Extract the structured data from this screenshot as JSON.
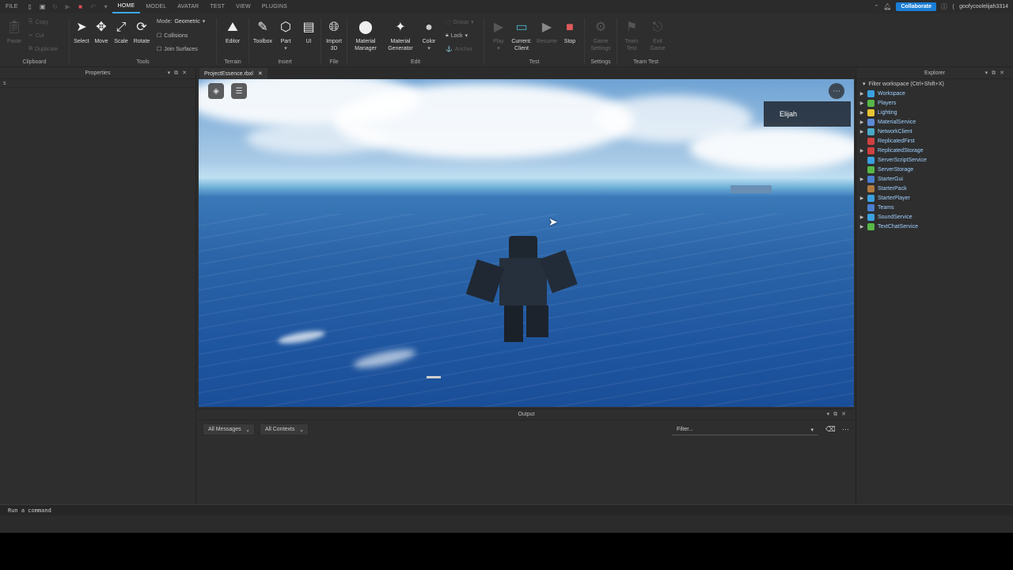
{
  "menu": {
    "file": "FILE",
    "tabs": [
      "HOME",
      "MODEL",
      "AVATAR",
      "TEST",
      "VIEW",
      "PLUGINS"
    ],
    "collaborate": "Collaborate",
    "username": "goofycoolelijah3314"
  },
  "ribbon": {
    "clipboard": {
      "label": "Clipboard",
      "paste": "Paste",
      "copy": "Copy",
      "cut": "Cut",
      "duplicate": "Duplicate"
    },
    "tools": {
      "label": "Tools",
      "select": "Select",
      "move": "Move",
      "scale": "Scale",
      "rotate": "Rotate",
      "mode_label": "Mode:",
      "mode_value": "Geometric",
      "collisions": "Collisions",
      "join_surfaces": "Join Surfaces"
    },
    "terrain": {
      "label": "Terrain",
      "editor": "Editor"
    },
    "insert": {
      "label": "Insert",
      "toolbox": "Toolbox",
      "part": "Part",
      "ui": "UI"
    },
    "file": {
      "label": "File",
      "import3d": "Import 3D"
    },
    "edit": {
      "label": "Edit",
      "material_manager": "Material Manager",
      "material_generator": "Material Generator",
      "color": "Color",
      "group": "Group",
      "lock": "Lock",
      "anchor": "Anchor"
    },
    "test": {
      "label": "Test",
      "play": "Play",
      "current_client": "Current: Client",
      "resume": "Resume",
      "stop": "Stop"
    },
    "settings": {
      "label": "Settings",
      "game_settings": "Game Settings"
    },
    "team_test": {
      "label": "Team Test",
      "team_test": "Team Test",
      "exit_game": "Exit Game"
    }
  },
  "properties": {
    "title": "Properties",
    "filter": "s"
  },
  "document_tab": "ProjectEssence.rbxl",
  "viewport": {
    "player_name": "Elijah"
  },
  "output": {
    "title": "Output",
    "messages": "All Messages",
    "contexts": "All Contexts",
    "filter": "Filter..."
  },
  "explorer": {
    "title": "Explorer",
    "filter": "Filter workspace (Ctrl+Shift+X)",
    "items": [
      {
        "name": "Workspace",
        "expand": true,
        "color": "#3aa0e0"
      },
      {
        "name": "Players",
        "expand": true,
        "color": "#58b847"
      },
      {
        "name": "Lighting",
        "expand": true,
        "color": "#e8c532"
      },
      {
        "name": "MaterialService",
        "expand": true,
        "color": "#5c8ad6"
      },
      {
        "name": "NetworkClient",
        "expand": true,
        "color": "#4aa8c8"
      },
      {
        "name": "ReplicatedFirst",
        "expand": false,
        "color": "#d04040"
      },
      {
        "name": "ReplicatedStorage",
        "expand": true,
        "color": "#d04040"
      },
      {
        "name": "ServerScriptService",
        "expand": false,
        "color": "#3aa0e0"
      },
      {
        "name": "ServerStorage",
        "expand": false,
        "color": "#58b847"
      },
      {
        "name": "StarterGui",
        "expand": true,
        "color": "#4a7fd0"
      },
      {
        "name": "StarterPack",
        "expand": false,
        "color": "#b07a40"
      },
      {
        "name": "StarterPlayer",
        "expand": true,
        "color": "#3aa0e0"
      },
      {
        "name": "Teams",
        "expand": false,
        "color": "#4a7fd0"
      },
      {
        "name": "SoundService",
        "expand": true,
        "color": "#3aa0e0"
      },
      {
        "name": "TextChatService",
        "expand": true,
        "color": "#58b847"
      }
    ]
  },
  "command": {
    "placeholder": "Run a command"
  }
}
